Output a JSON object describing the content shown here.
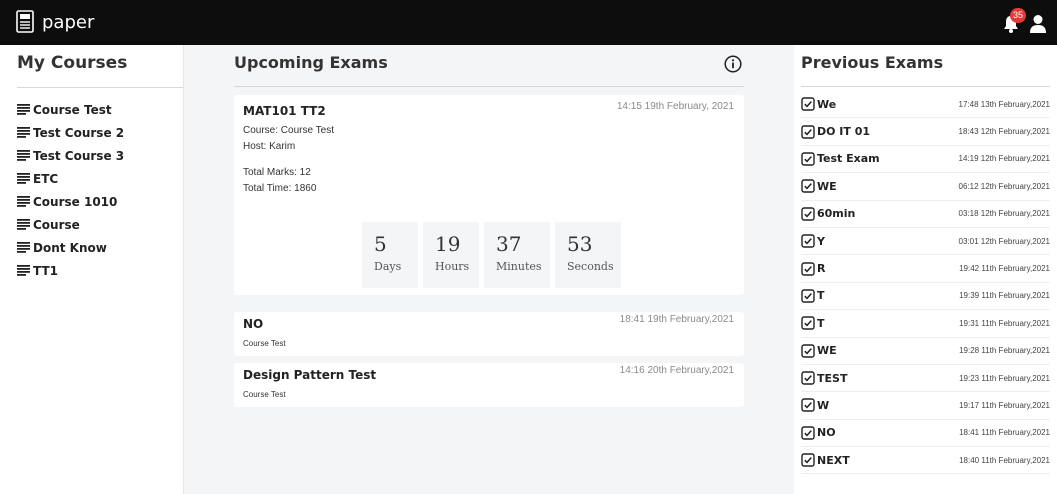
{
  "header": {
    "brand": "paper",
    "notification_count": "35"
  },
  "sidebar": {
    "title": "My Courses",
    "courses": [
      "Course Test",
      "Test Course 2",
      "Test Course 3",
      "ETC",
      "Course 1010",
      "Course",
      "Dont Know",
      "TT1"
    ]
  },
  "upcoming": {
    "title": "Upcoming Exams",
    "main_exam": {
      "title": "MAT101 TT2",
      "time": "14:15 19th February, 2021",
      "course": "Course: Course Test",
      "host": "Host: Karim",
      "total_marks": "Total Marks: 12",
      "total_time": "Total Time: 1860",
      "countdown": {
        "days": "5",
        "days_label": "Days",
        "hours": "19",
        "hours_label": "Hours",
        "minutes": "37",
        "minutes_label": "Minutes",
        "seconds": "53",
        "seconds_label": "Seconds"
      }
    },
    "other_exams": [
      {
        "title": "NO",
        "time": "18:41 19th February,2021",
        "course": "Course Test"
      },
      {
        "title": "Design Pattern Test",
        "time": "14:16 20th February,2021",
        "course": "Course Test"
      }
    ]
  },
  "previous": {
    "title": "Previous Exams",
    "items": [
      {
        "name": "We",
        "time": "17:48 13th February,2021"
      },
      {
        "name": "DO IT 01",
        "time": "18:43 12th February,2021"
      },
      {
        "name": "Test Exam",
        "time": "14:19 12th February,2021"
      },
      {
        "name": "WE",
        "time": "06:12 12th February,2021"
      },
      {
        "name": "60min",
        "time": "03:18 12th February,2021"
      },
      {
        "name": "Y",
        "time": "03:01 12th February,2021"
      },
      {
        "name": "R",
        "time": "19:42 11th February,2021"
      },
      {
        "name": "T",
        "time": "19:39 11th February,2021"
      },
      {
        "name": "T",
        "time": "19:31 11th February,2021"
      },
      {
        "name": "WE",
        "time": "19:28 11th February,2021"
      },
      {
        "name": "TEST",
        "time": "19:23 11th February,2021"
      },
      {
        "name": "W",
        "time": "19:17 11th February,2021"
      },
      {
        "name": "NO",
        "time": "18:41 11th February,2021"
      },
      {
        "name": "NEXT",
        "time": "18:40 11th February,2021"
      }
    ]
  }
}
